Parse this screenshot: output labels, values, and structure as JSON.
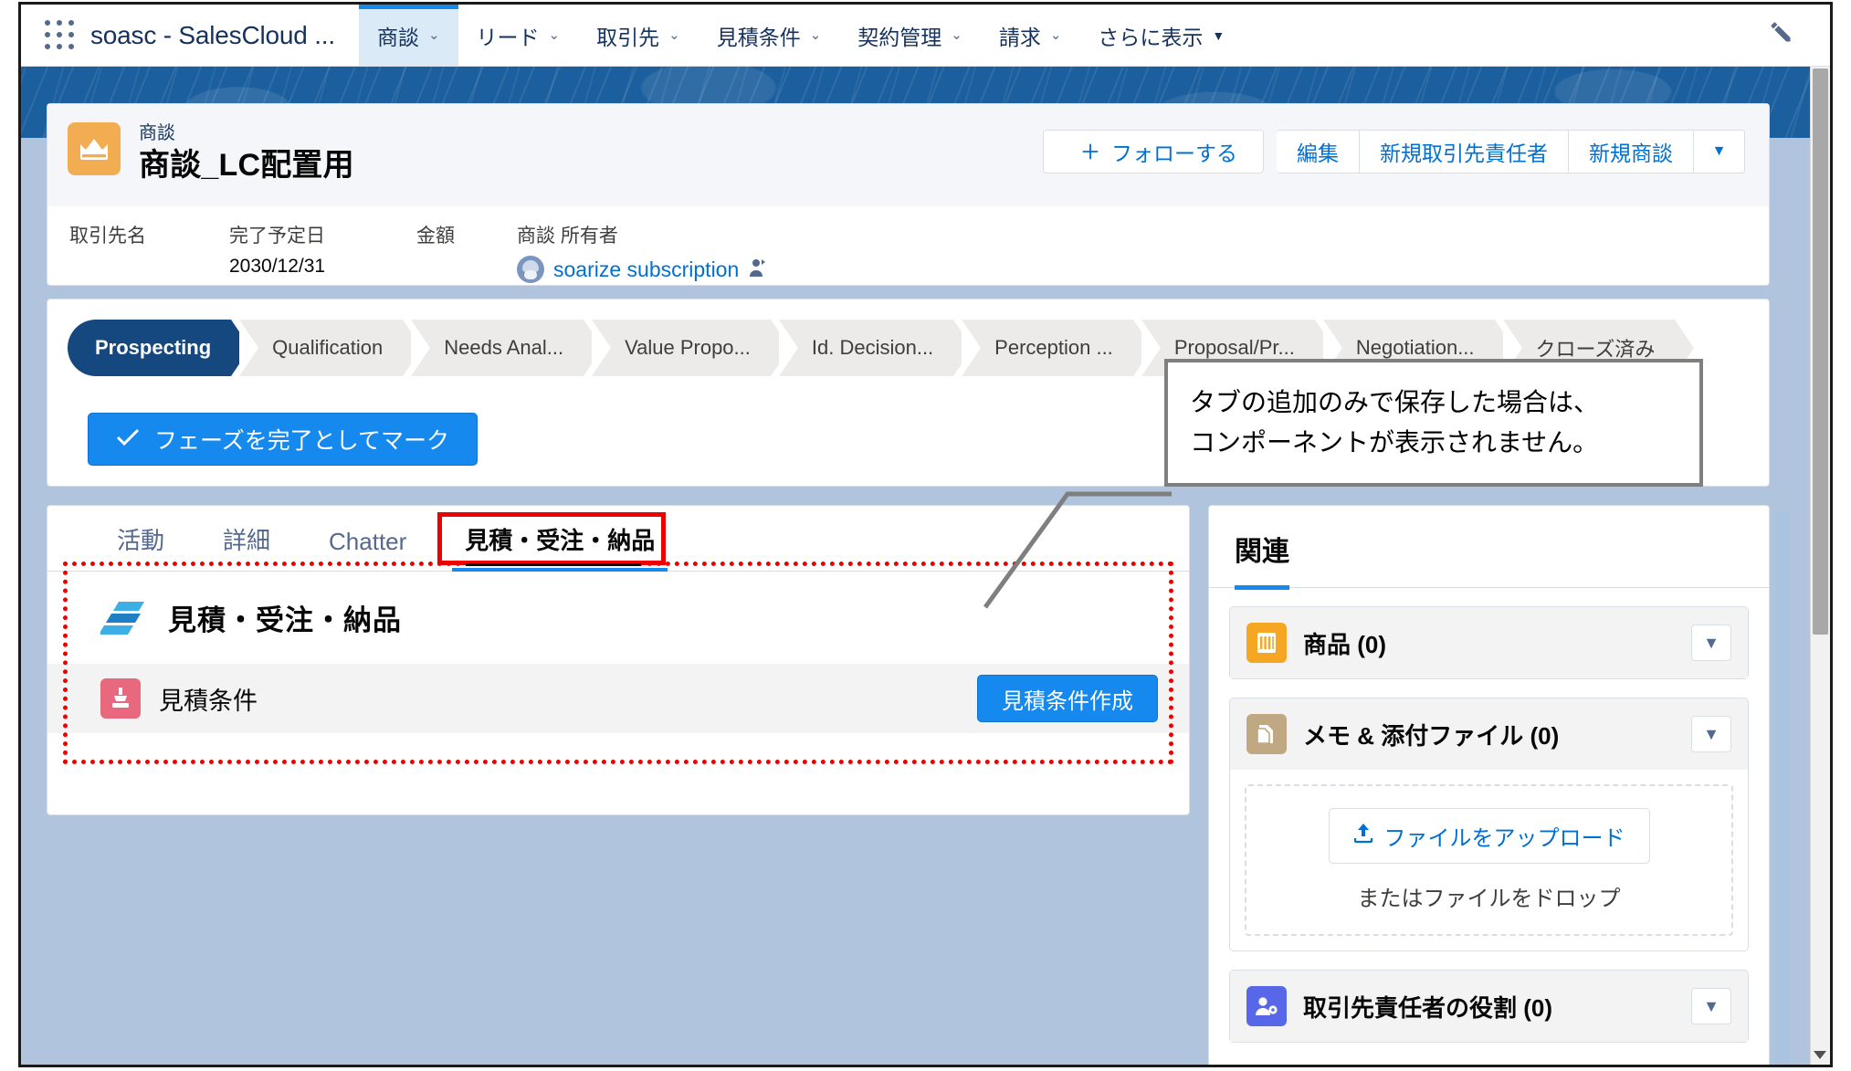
{
  "global_nav": {
    "app_launcher_icon": "waffle-icon",
    "app_name": "soasc - SalesCloud ...",
    "edit_icon": "pencil-icon",
    "tabs": [
      {
        "label": "商談",
        "active": true,
        "caret": "⌄"
      },
      {
        "label": "リード",
        "active": false,
        "caret": "⌄"
      },
      {
        "label": "取引先",
        "active": false,
        "caret": "⌄"
      },
      {
        "label": "見積条件",
        "active": false,
        "caret": "⌄"
      },
      {
        "label": "契約管理",
        "active": false,
        "caret": "⌄"
      },
      {
        "label": "請求",
        "active": false,
        "caret": "⌄"
      },
      {
        "label": "さらに表示",
        "active": false,
        "caret": "▼"
      }
    ]
  },
  "record_header": {
    "object_label": "商談",
    "object_icon": "crown-icon",
    "record_title": "商談_LC配置用",
    "actions": {
      "follow": "フォローする",
      "follow_icon": "plus-icon",
      "edit": "編集",
      "new_contact": "新規取引先責任者",
      "new_opportunity": "新規商談",
      "more_caret": "▼"
    },
    "fields": [
      {
        "label": "取引先名",
        "value": ""
      },
      {
        "label": "完了予定日",
        "value": "2030/12/31"
      },
      {
        "label": "金額",
        "value": ""
      }
    ],
    "owner": {
      "label": "商談 所有者",
      "name": "soarize subscription",
      "avatar_icon": "user-avatar-icon",
      "change_owner_icon": "change-owner-icon"
    }
  },
  "path": {
    "stages": [
      {
        "label": "Prospecting",
        "state": "current"
      },
      {
        "label": "Qualification",
        "state": "incomplete"
      },
      {
        "label": "Needs Anal...",
        "state": "incomplete"
      },
      {
        "label": "Value Propo...",
        "state": "incomplete"
      },
      {
        "label": "Id. Decision...",
        "state": "incomplete"
      },
      {
        "label": "Perception ...",
        "state": "incomplete"
      },
      {
        "label": "Proposal/Pr...",
        "state": "incomplete"
      },
      {
        "label": "Negotiation...",
        "state": "incomplete"
      },
      {
        "label": "クローズ済み",
        "state": "incomplete"
      }
    ],
    "mark_complete_label": "フェーズを完了としてマーク",
    "mark_complete_icon": "check-icon"
  },
  "main": {
    "tabs": [
      {
        "label": "活動",
        "selected": false
      },
      {
        "label": "詳細",
        "selected": false
      },
      {
        "label": "Chatter",
        "selected": false
      },
      {
        "label": "見積・受注・納品",
        "selected": true
      }
    ],
    "component": {
      "logo_icon": "soarize-logo-icon",
      "title": "見積・受注・納品",
      "row": {
        "icon": "quote-condition-icon",
        "label": "見積条件",
        "button_label": "見積条件作成"
      }
    }
  },
  "right_panel": {
    "tab_label": "関連",
    "cards": [
      {
        "title": "商品 (0)",
        "icon": "product-icon",
        "icon_color": "#f5a623",
        "caret": "▼",
        "has_dropzone": false
      },
      {
        "title": "メモ & 添付ファイル (0)",
        "icon": "notes-attachments-icon",
        "icon_color": "#bfa882",
        "caret": "▼",
        "has_dropzone": true,
        "upload_label": "ファイルをアップロード",
        "upload_icon": "upload-icon",
        "drop_label": "またはファイルをドロップ"
      },
      {
        "title": "取引先責任者の役割 (0)",
        "icon": "contact-role-icon",
        "icon_color": "#5867e8",
        "caret": "▼",
        "has_dropzone": false
      }
    ]
  },
  "annotation": {
    "line1": "タブの追加のみで保存した場合は、",
    "line2": "コンポーネントが表示されません。",
    "border_color": "#7f7f7f",
    "leader_color": "#7f7f7f"
  },
  "highlights": {
    "tab_box_color": "#ee0000",
    "region_box_color": "#ee0000"
  },
  "colors": {
    "brand_blue": "#1589ee",
    "link_blue": "#0070d2",
    "header_blue": "#1b5f9e",
    "path_current": "#14487f"
  }
}
